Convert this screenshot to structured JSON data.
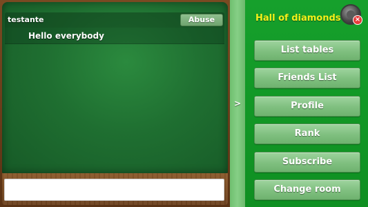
{
  "chat": {
    "username": "testante",
    "abuse_label": "Abuse",
    "message": "Hello everybody",
    "input_value": ""
  },
  "divider": {
    "toggle_label": ">"
  },
  "menu": {
    "room_title": "Hall of diamonds",
    "close_badge": "×",
    "buttons": [
      "List tables",
      "Friends List",
      "Profile",
      "Rank",
      "Subscribe",
      "Change room"
    ]
  },
  "colors": {
    "felt": "#1f6f31",
    "menu_panel": "#129826",
    "title_yellow": "#f5f01a",
    "button_green": "#7fbf7f",
    "wood": "#7a4a22"
  },
  "icons": {
    "close": "close-icon"
  }
}
